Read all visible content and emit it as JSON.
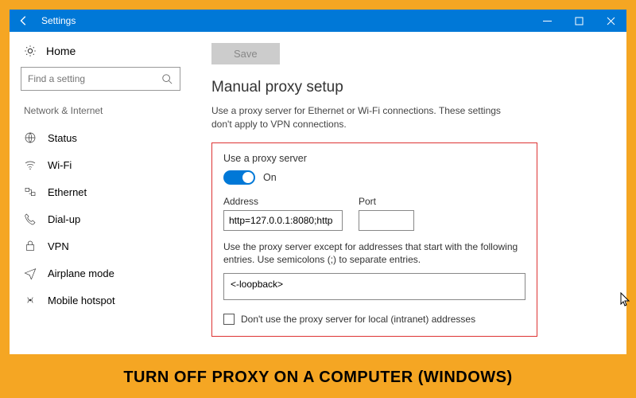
{
  "titlebar": {
    "title": "Settings"
  },
  "sidebar": {
    "home": "Home",
    "search_placeholder": "Find a setting",
    "group": "Network & Internet",
    "items": [
      {
        "label": "Status"
      },
      {
        "label": "Wi-Fi"
      },
      {
        "label": "Ethernet"
      },
      {
        "label": "Dial-up"
      },
      {
        "label": "VPN"
      },
      {
        "label": "Airplane mode"
      },
      {
        "label": "Mobile hotspot"
      }
    ]
  },
  "main": {
    "save": "Save",
    "heading": "Manual proxy setup",
    "desc": "Use a proxy server for Ethernet or Wi-Fi connections. These settings don't apply to VPN connections.",
    "use_proxy_label": "Use a proxy server",
    "toggle_state": "On",
    "addr_label": "Address",
    "addr_value": "http=127.0.0.1:8080;http",
    "port_label": "Port",
    "port_value": "",
    "except_desc": "Use the proxy server except for addresses that start with the following entries. Use semicolons (;) to separate entries.",
    "except_value": "<-loopback>",
    "local_label": "Don't use the proxy server for local (intranet) addresses"
  },
  "caption": "TURN OFF PROXY ON A COMPUTER (WINDOWS)"
}
